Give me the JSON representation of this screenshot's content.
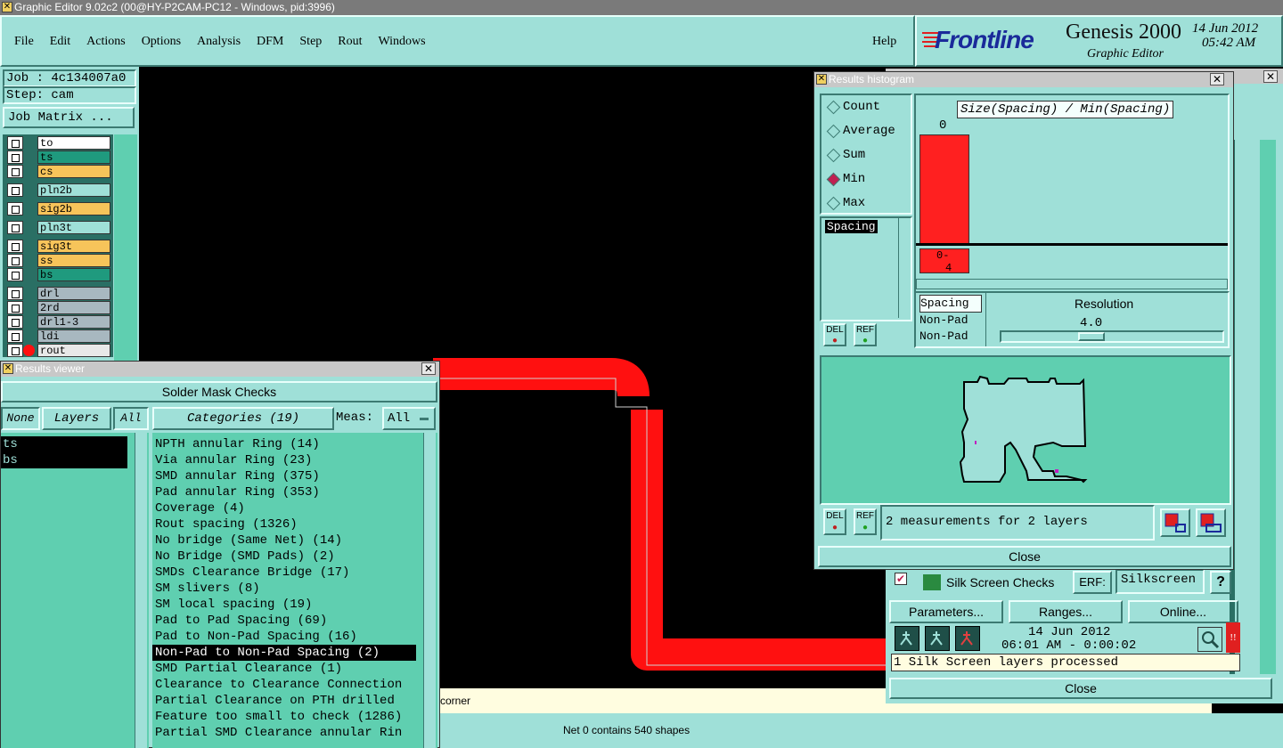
{
  "window": {
    "title": "Graphic Editor 9.02c2 (00@HY-P2CAM-PC12 - Windows, pid:3996)"
  },
  "menu": [
    "File",
    "Edit",
    "Actions",
    "Options",
    "Analysis",
    "DFM",
    "Step",
    "Rout",
    "Windows"
  ],
  "help": "Help",
  "brand": {
    "logo": "Frontline",
    "product": "Genesis 2000",
    "subtitle": "Graphic Editor",
    "date": "14 Jun 2012",
    "time": "05:42 AM"
  },
  "job": {
    "job_label": "Job : 4c134007a0",
    "step_label": "Step: cam",
    "matrix_button": "Job Matrix ..."
  },
  "layers": [
    {
      "name": "to",
      "color": "#ffffff"
    },
    {
      "name": "ts",
      "color": "#1f9a7e"
    },
    {
      "name": "cs",
      "color": "#f7c45a"
    },
    {
      "name": "pln2b",
      "color": "#9fe0d8"
    },
    {
      "name": "sig2b",
      "color": "#f7c45a"
    },
    {
      "name": "pln3t",
      "color": "#9fe0d8"
    },
    {
      "name": "sig3t",
      "color": "#f7c45a"
    },
    {
      "name": "ss",
      "color": "#f7c45a"
    },
    {
      "name": "bs",
      "color": "#1f9a7e"
    },
    {
      "name": "drl",
      "color": "#a8b8c0"
    },
    {
      "name": "2rd",
      "color": "#a8b8c0"
    },
    {
      "name": "drl1-3",
      "color": "#a8b8c0"
    },
    {
      "name": "ldi",
      "color": "#a8b8c0"
    },
    {
      "name": "rout",
      "color": "#e8e8e8"
    }
  ],
  "results_viewer": {
    "title": "Results viewer",
    "check_name": "Solder Mask Checks",
    "none_btn": "None",
    "layers_btn": "Layers",
    "all_btn": "All",
    "categories_header": "Categories (19)",
    "meas_label": "Meas:",
    "meas_value": "All",
    "layer_list": [
      "ts",
      "bs"
    ],
    "categories": [
      "NPTH annular Ring (14)",
      "Via annular Ring (23)",
      "SMD annular Ring (375)",
      "Pad annular Ring (353)",
      "Coverage (4)",
      "Rout spacing (1326)",
      "No bridge (Same Net) (14)",
      "No Bridge (SMD Pads) (2)",
      "SMDs Clearance Bridge (17)",
      "SM slivers (8)",
      "SM local spacing (19)",
      "Pad to Pad Spacing (69)",
      "Pad to Non-Pad Spacing (16)",
      "Non-Pad to Non-Pad Spacing (2)",
      "SMD Partial Clearance (1)",
      "Clearance to Clearance Connection",
      "Partial Clearance on PTH drilled",
      "Feature too small to check (1286)",
      "Partial SMD Clearance annular Rin"
    ],
    "selected_category": "Non-Pad to Non-Pad Spacing (2)"
  },
  "histogram": {
    "title": "Results histogram",
    "modes": [
      "Count",
      "Average",
      "Sum",
      "Min",
      "Max"
    ],
    "selected_mode": "Min",
    "measure_list": [
      "Spacing"
    ],
    "chart_title": "Size(Spacing) / Min(Spacing)",
    "bar_value_label": "0",
    "bin_label_top": "0-",
    "bin_label_bottom": "4",
    "bar_color": "#ff2020",
    "res_list": [
      "Spacing",
      "Non-Pad",
      "Non-Pad"
    ],
    "resolution_label": "Resolution",
    "resolution_value": "4.0",
    "del": "DEL",
    "ref": "REF",
    "measurements_text": "2 measurements for 2 layers",
    "close": "Close"
  },
  "back_panel": {
    "checkbox_label": "Silk Screen Checks",
    "erf_label": "ERF:",
    "erf_value": "Silkscreen",
    "help_icon": "?",
    "params_btn": "Parameters...",
    "ranges_btn": "Ranges...",
    "online_btn": "Online...",
    "date": "14 Jun 2012",
    "time": "06:01 AM - 0:00:02",
    "status": "1 Silk Screen layers processed",
    "close": "Close"
  },
  "status": {
    "message": "corner",
    "net_info": "Net 0 contains 540 shapes"
  }
}
